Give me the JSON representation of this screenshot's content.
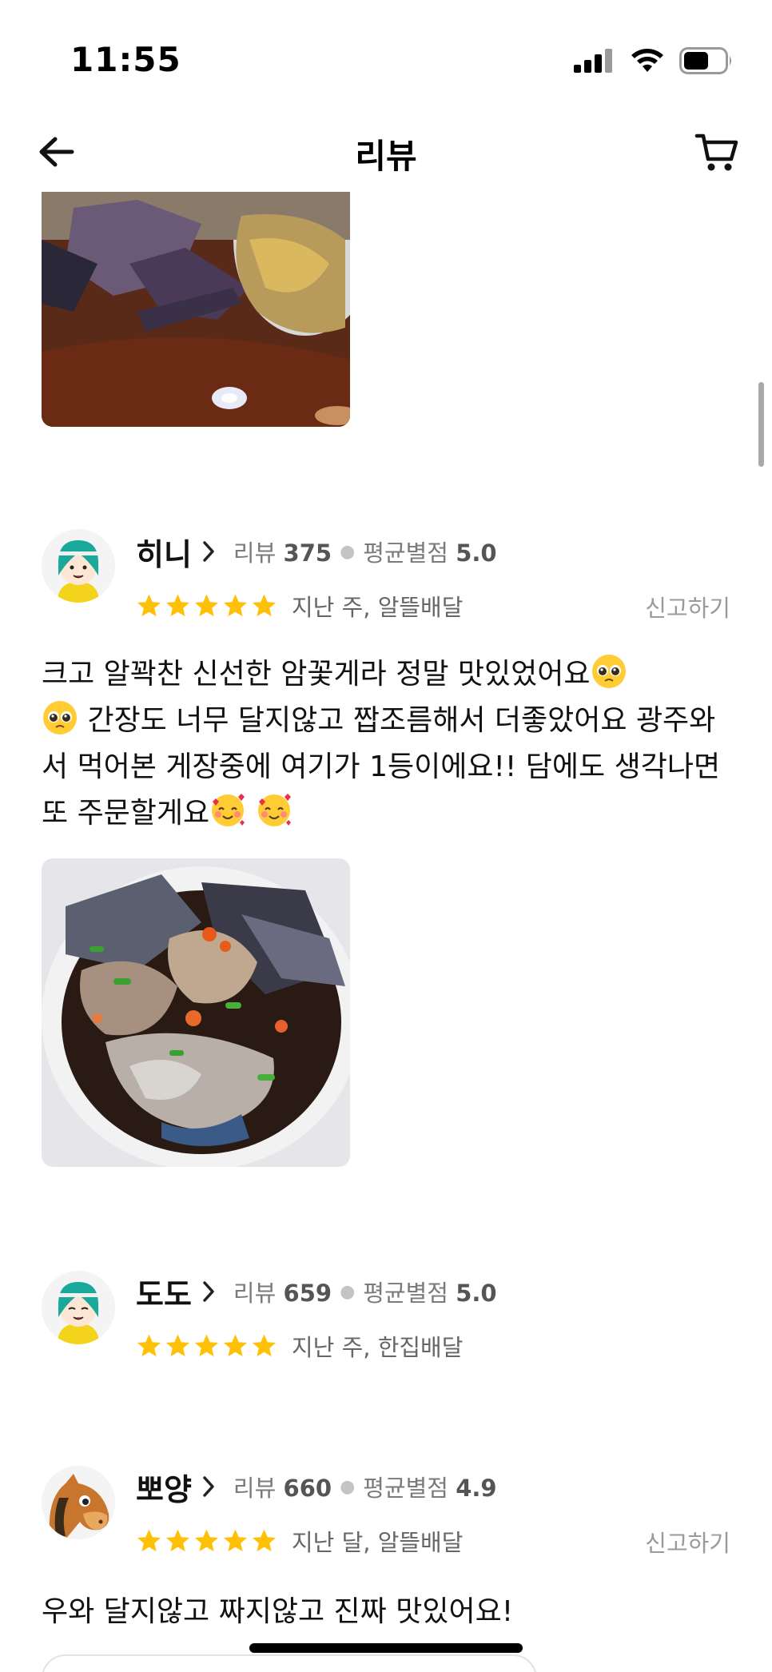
{
  "status": {
    "time": "11:55"
  },
  "nav": {
    "title": "리뷰",
    "back_icon": "arrow-left-icon",
    "cart_icon": "cart-icon"
  },
  "reviews": [
    {
      "nickname": "히니",
      "review_label": "리뷰",
      "review_count": "375",
      "avg_label": "평균별점",
      "avg_rating": "5.0",
      "rating": 5,
      "when_channel": "지난 주, 알뜰배달",
      "report": "신고하기",
      "text_parts": [
        "크고 알꽉찬 신선한 암꽃게라 정말 맛있었어요",
        " 간장도 너무 달지않고 짭조름해서 더좋았어요 광주와서 먹어본 게장중에 여기가 1등이에요!! 담에도 생각나면 또 주문할게요",
        " "
      ]
    },
    {
      "nickname": "도도",
      "review_label": "리뷰",
      "review_count": "659",
      "avg_label": "평균별점",
      "avg_rating": "5.0",
      "rating": 5,
      "when_channel": "지난 주, 한집배달"
    },
    {
      "nickname": "뽀양",
      "review_label": "리뷰",
      "review_count": "660",
      "avg_label": "평균별점",
      "avg_rating": "4.9",
      "rating": 5,
      "when_channel": "지난 달, 알뜰배달",
      "report": "신고하기",
      "text": "우와 달지않고 짜지않고 진짜 맛있어요!"
    }
  ],
  "colors": {
    "star": "#ffc107",
    "accent_text": "#111111",
    "muted": "#7a7a7a"
  }
}
